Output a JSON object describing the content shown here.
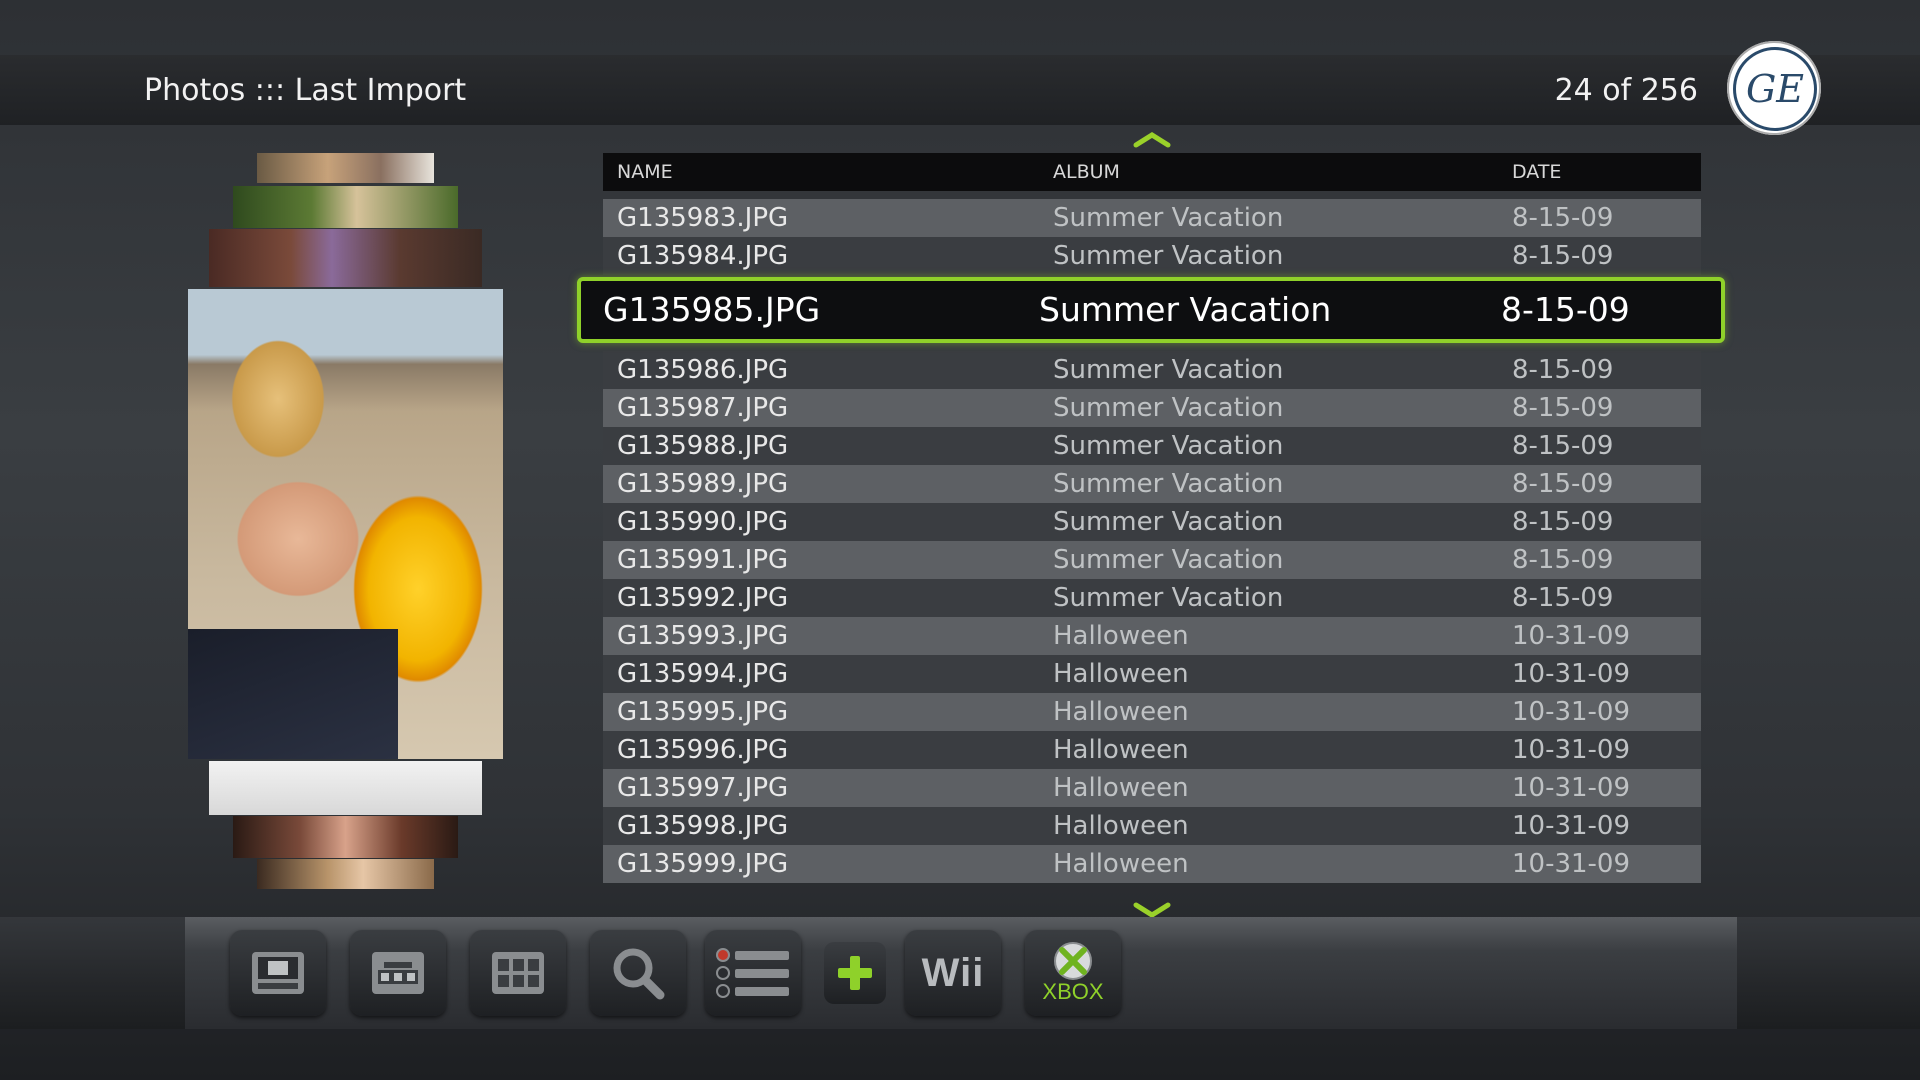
{
  "header": {
    "title": "Photos ::: Last Import",
    "counter": "24 of 256",
    "logo_text": "GE"
  },
  "table": {
    "columns": [
      "NAME",
      "ALBUM",
      "DATE"
    ],
    "rows": [
      {
        "name": "G135983.JPG",
        "album": "Summer Vacation",
        "date": "8-15-09"
      },
      {
        "name": "G135984.JPG",
        "album": "Summer Vacation",
        "date": "8-15-09"
      },
      {
        "name": "G135986.JPG",
        "album": "Summer Vacation",
        "date": "8-15-09"
      },
      {
        "name": "G135987.JPG",
        "album": "Summer Vacation",
        "date": "8-15-09"
      },
      {
        "name": "G135988.JPG",
        "album": "Summer Vacation",
        "date": "8-15-09"
      },
      {
        "name": "G135989.JPG",
        "album": "Summer Vacation",
        "date": "8-15-09"
      },
      {
        "name": "G135990.JPG",
        "album": "Summer Vacation",
        "date": "8-15-09"
      },
      {
        "name": "G135991.JPG",
        "album": "Summer Vacation",
        "date": "8-15-09"
      },
      {
        "name": "G135992.JPG",
        "album": "Summer Vacation",
        "date": "8-15-09"
      },
      {
        "name": "G135993.JPG",
        "album": "Halloween",
        "date": "10-31-09"
      },
      {
        "name": "G135994.JPG",
        "album": "Halloween",
        "date": "10-31-09"
      },
      {
        "name": "G135995.JPG",
        "album": "Halloween",
        "date": "10-31-09"
      },
      {
        "name": "G135996.JPG",
        "album": "Halloween",
        "date": "10-31-09"
      },
      {
        "name": "G135997.JPG",
        "album": "Halloween",
        "date": "10-31-09"
      },
      {
        "name": "G135998.JPG",
        "album": "Halloween",
        "date": "10-31-09"
      },
      {
        "name": "G135999.JPG",
        "album": "Halloween",
        "date": "10-31-09"
      }
    ],
    "selected": {
      "name": "G135985.JPG",
      "album": "Summer Vacation",
      "date": "8-15-09"
    }
  },
  "dock": {
    "wii_label": "Wii",
    "xbox_label": "XBOX"
  },
  "colors": {
    "accent": "#8fd12a",
    "row_light": "#5d6064",
    "row_dark": "#3a3d41"
  },
  "icons": [
    "chevron-up-icon",
    "chevron-down-icon",
    "filmstrip-icon",
    "carousel-icon",
    "grid-icon",
    "search-icon",
    "list-icon",
    "add-icon",
    "wii-icon",
    "xbox-icon"
  ]
}
